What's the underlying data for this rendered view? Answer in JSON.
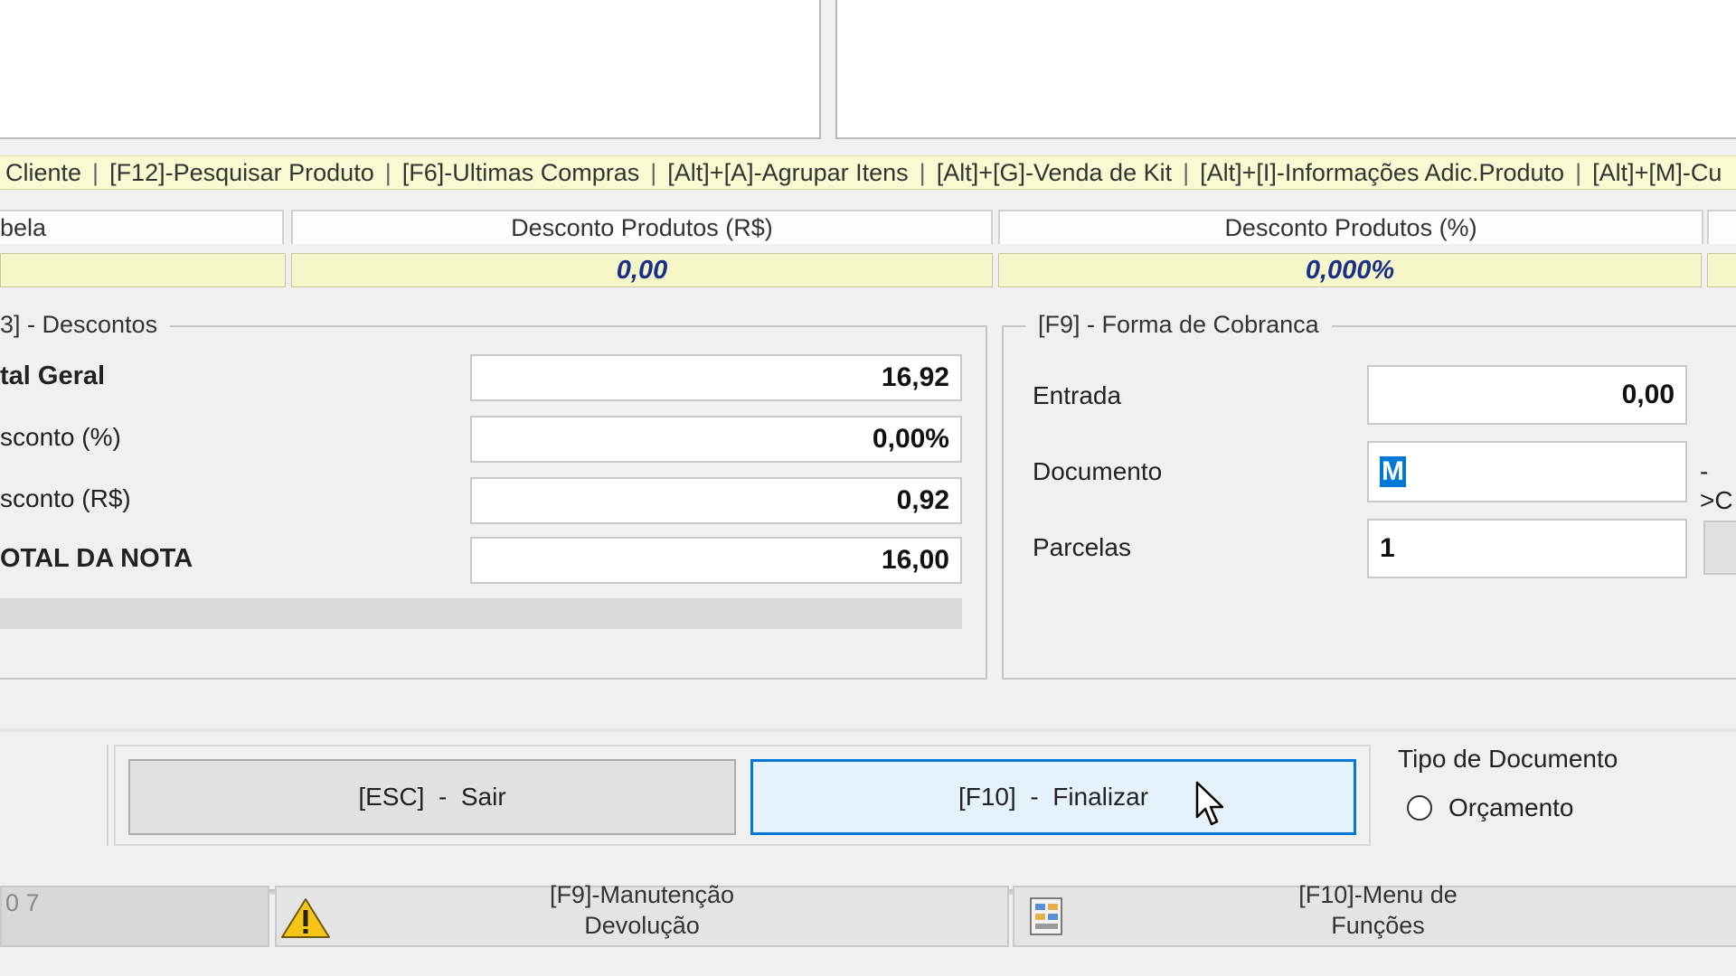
{
  "shortcuts": [
    "Cliente",
    "[F12]-Pesquisar Produto",
    "[F6]-Ultimas Compras",
    "[Alt]+[A]-Agrupar Itens",
    "[Alt]+[G]-Venda de Kit",
    "[Alt]+[I]-Informações Adic.Produto",
    "[Alt]+[M]-Cu"
  ],
  "summary": {
    "tabela_header": "bela",
    "desc_rs_header": "Desconto Produtos (R$)",
    "desc_rs_value": "0,00",
    "desc_pct_header": "Desconto Produtos (%)",
    "desc_pct_value": "0,000%"
  },
  "descontos": {
    "title": "3] - Descontos",
    "total_geral_label": "tal Geral",
    "total_geral_value": "16,92",
    "desconto_pct_label": "sconto (%)",
    "desconto_pct_value": "0,00%",
    "desconto_rs_label": "sconto (R$)",
    "desconto_rs_value": "0,92",
    "total_nota_label": "OTAL DA NOTA",
    "total_nota_value": "16,00"
  },
  "cobranca": {
    "title": "[F9] - Forma de Cobranca",
    "entrada_label": "Entrada",
    "entrada_value": "0,00",
    "documento_label": "Documento",
    "documento_value": "M",
    "documento_hint": "->C",
    "parcelas_label": "Parcelas",
    "parcelas_value": "1"
  },
  "actions": {
    "sair_label": "[ESC]  -  Sair",
    "finalizar_label": "[F10]  -  Finalizar"
  },
  "tipo_documento": {
    "title": "Tipo de Documento",
    "option_orcamento": "Orçamento"
  },
  "taskbar": {
    "left_fragment": "0 7",
    "devolucao_line1": "[F9]-Manutenção",
    "devolucao_line2": "Devolução",
    "menu_line1": "[F10]-Menu de",
    "menu_line2": "Funções"
  },
  "colors": {
    "accent": "#0078d7",
    "value_blue": "#1a2f8c",
    "shortcut_bg": "#fafad2"
  }
}
